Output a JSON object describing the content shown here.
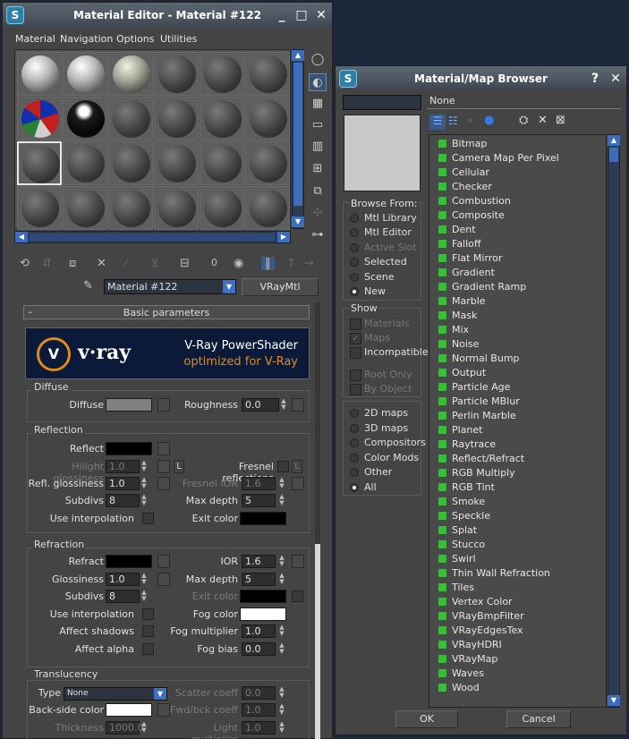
{
  "editor": {
    "title": "Material Editor - Material #122",
    "menus": [
      "Material",
      "Navigation",
      "Options",
      "Utilities"
    ],
    "mtl_name": "Material #122",
    "mtl_type": "VRayMtl",
    "rollout_title": "Basic parameters",
    "banner": {
      "logo": "v·ray",
      "line1": "V-Ray PowerShader",
      "line2": "optimized for V-Ray"
    },
    "diffuse": {
      "group": "Diffuse",
      "diffuse_label": "Diffuse",
      "roughness_label": "Roughness",
      "roughness": "0.0"
    },
    "reflection": {
      "group": "Reflection",
      "reflect_label": "Reflect",
      "hilight_label": "Hilight glossiness",
      "hilight": "1.0",
      "l": "L",
      "fresnel_label": "Fresnel reflections",
      "refl_gloss_label": "Refl. glossiness",
      "refl_gloss": "1.0",
      "fresnel_ior_label": "Fresnel IOR",
      "fresnel_ior": "1.6",
      "subdivs_label": "Subdivs",
      "subdivs": "8",
      "maxdepth_label": "Max depth",
      "maxdepth": "5",
      "interp_label": "Use interpolation",
      "exit_label": "Exit color"
    },
    "refraction": {
      "group": "Refraction",
      "refract_label": "Refract",
      "ior_label": "IOR",
      "ior": "1.6",
      "gloss_label": "Glossiness",
      "gloss": "1.0",
      "maxdepth_label": "Max depth",
      "maxdepth": "5",
      "subdivs_label": "Subdivs",
      "subdivs": "8",
      "exit_label": "Exit color",
      "interp_label": "Use interpolation",
      "fog_label": "Fog color",
      "shadows_label": "Affect shadows",
      "fogmult_label": "Fog multiplier",
      "fogmult": "1.0",
      "alpha_label": "Affect alpha",
      "fogbias_label": "Fog bias",
      "fogbias": "0.0"
    },
    "translucency": {
      "group": "Translucency",
      "type_label": "Type",
      "type": "None",
      "scatter_label": "Scatter coeff",
      "scatter": "0.0",
      "backside_label": "Back-side color",
      "fwdbck_label": "Fwd/bck coeff",
      "fwdbck": "1.0",
      "thickness_label": "Thickness",
      "thickness": "1000.0",
      "light_label": "Light multiplier",
      "light": "1.0"
    }
  },
  "browser": {
    "title": "Material/Map Browser",
    "help": "?",
    "name": "None",
    "browse_title": "Browse From:",
    "browse": [
      {
        "label": "Mtl Library",
        "on": false,
        "dis": false
      },
      {
        "label": "Mtl Editor",
        "on": false,
        "dis": false
      },
      {
        "label": "Active Slot",
        "on": false,
        "dis": true
      },
      {
        "label": "Selected",
        "on": false,
        "dis": false
      },
      {
        "label": "Scene",
        "on": false,
        "dis": false
      },
      {
        "label": "New",
        "on": true,
        "dis": false
      }
    ],
    "show_title": "Show",
    "show": [
      {
        "label": "Materials",
        "dis": true
      },
      {
        "label": "Maps",
        "dis": true
      },
      {
        "label": "Incompatible",
        "dis": false
      }
    ],
    "root": [
      {
        "label": "Root Only"
      },
      {
        "label": "By Object"
      }
    ],
    "filter": [
      {
        "label": "2D maps",
        "on": false
      },
      {
        "label": "3D maps",
        "on": false
      },
      {
        "label": "Compositors",
        "on": false
      },
      {
        "label": "Color Mods",
        "on": false
      },
      {
        "label": "Other",
        "on": false
      },
      {
        "label": "All",
        "on": true
      }
    ],
    "maps": [
      "Bitmap",
      "Camera Map Per Pixel",
      "Cellular",
      "Checker",
      "Combustion",
      "Composite",
      "Dent",
      "Falloff",
      "Flat Mirror",
      "Gradient",
      "Gradient Ramp",
      "Marble",
      "Mask",
      "Mix",
      "Noise",
      "Normal Bump",
      "Output",
      "Particle Age",
      "Particle MBlur",
      "Perlin Marble",
      "Planet",
      "Raytrace",
      "Reflect/Refract",
      "RGB Multiply",
      "RGB Tint",
      "Smoke",
      "Speckle",
      "Splat",
      "Stucco",
      "Swirl",
      "Thin Wall Refraction",
      "Tiles",
      "Vertex Color",
      "VRayBmpFilter",
      "VRayEdgesTex",
      "VRayHDRI",
      "VRayMap",
      "Waves",
      "Wood"
    ],
    "ok": "OK",
    "cancel": "Cancel"
  }
}
